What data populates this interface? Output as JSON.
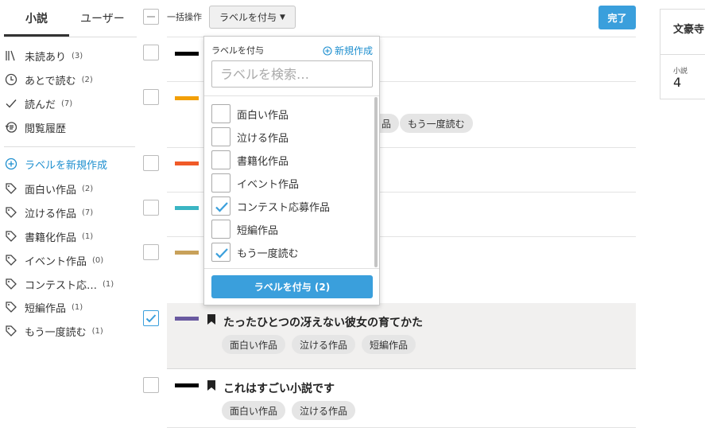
{
  "tabs": [
    {
      "label": "小説",
      "active": true
    },
    {
      "label": "ユーザー",
      "active": false
    }
  ],
  "sidebar": {
    "status_items": [
      {
        "icon": "bookshelf-icon",
        "label": "未読あり",
        "count": "(3)"
      },
      {
        "icon": "clock-icon",
        "label": "あとで読む",
        "count": "(2)"
      },
      {
        "icon": "check-icon",
        "label": "読んだ",
        "count": "(7)"
      },
      {
        "icon": "history-icon",
        "label": "閲覧履歴",
        "count": ""
      }
    ],
    "new_label": "ラベルを新規作成",
    "labels": [
      {
        "label": "面白い作品",
        "count": "(2)"
      },
      {
        "label": "泣ける作品",
        "count": "(7)"
      },
      {
        "label": "書籍化作品",
        "count": "(1)"
      },
      {
        "label": "イベント作品",
        "count": "(0)"
      },
      {
        "label": "コンテスト応…",
        "count": "(1)"
      },
      {
        "label": "短編作品",
        "count": "(1)"
      },
      {
        "label": "もう一度読む",
        "count": "(1)"
      }
    ]
  },
  "toolbar": {
    "bulk_label": "一括操作",
    "label_button": "ラベルを付与",
    "done_button": "完了"
  },
  "dropdown": {
    "title": "ラベルを付与",
    "new_label": "新規作成",
    "search_placeholder": "ラベルを検索…",
    "items": [
      {
        "label": "面白い作品",
        "checked": false
      },
      {
        "label": "泣ける作品",
        "checked": false
      },
      {
        "label": "書籍化作品",
        "checked": false
      },
      {
        "label": "イベント作品",
        "checked": false
      },
      {
        "label": "コンテスト応募作品",
        "checked": true
      },
      {
        "label": "短編作品",
        "checked": false
      },
      {
        "label": "もう一度読む",
        "checked": true
      }
    ],
    "apply_button": "ラベルを付与 (2)"
  },
  "novels": [
    {
      "color": "#000000",
      "title": "",
      "tags": [],
      "checked": false
    },
    {
      "color": "#f29f05",
      "title": "",
      "tags": [
        "品",
        "もう一度読む"
      ],
      "checked": false
    },
    {
      "color": "#f05a28",
      "title": "",
      "tags": [],
      "checked": false
    },
    {
      "color": "#3ab5c3",
      "title": "",
      "tags": [],
      "checked": false
    },
    {
      "color": "#c8a15a",
      "title": "",
      "tags": [],
      "checked": false
    },
    {
      "color": "#6a5aa0",
      "title": "たったひとつの冴えない彼女の育てかた",
      "tags": [
        "面白い作品",
        "泣ける作品",
        "短編作品"
      ],
      "checked": true
    },
    {
      "color": "#000000",
      "title": "これはすごい小説です",
      "tags": [
        "面白い作品",
        "泣ける作品"
      ],
      "checked": false
    }
  ],
  "author": {
    "name": "文豪寺",
    "stat_label": "小説",
    "stat_value": "4"
  },
  "colors": {
    "accent": "#3a9fdc",
    "link": "#1e8fcf",
    "selected_row_bg": "#f1f0ef"
  }
}
